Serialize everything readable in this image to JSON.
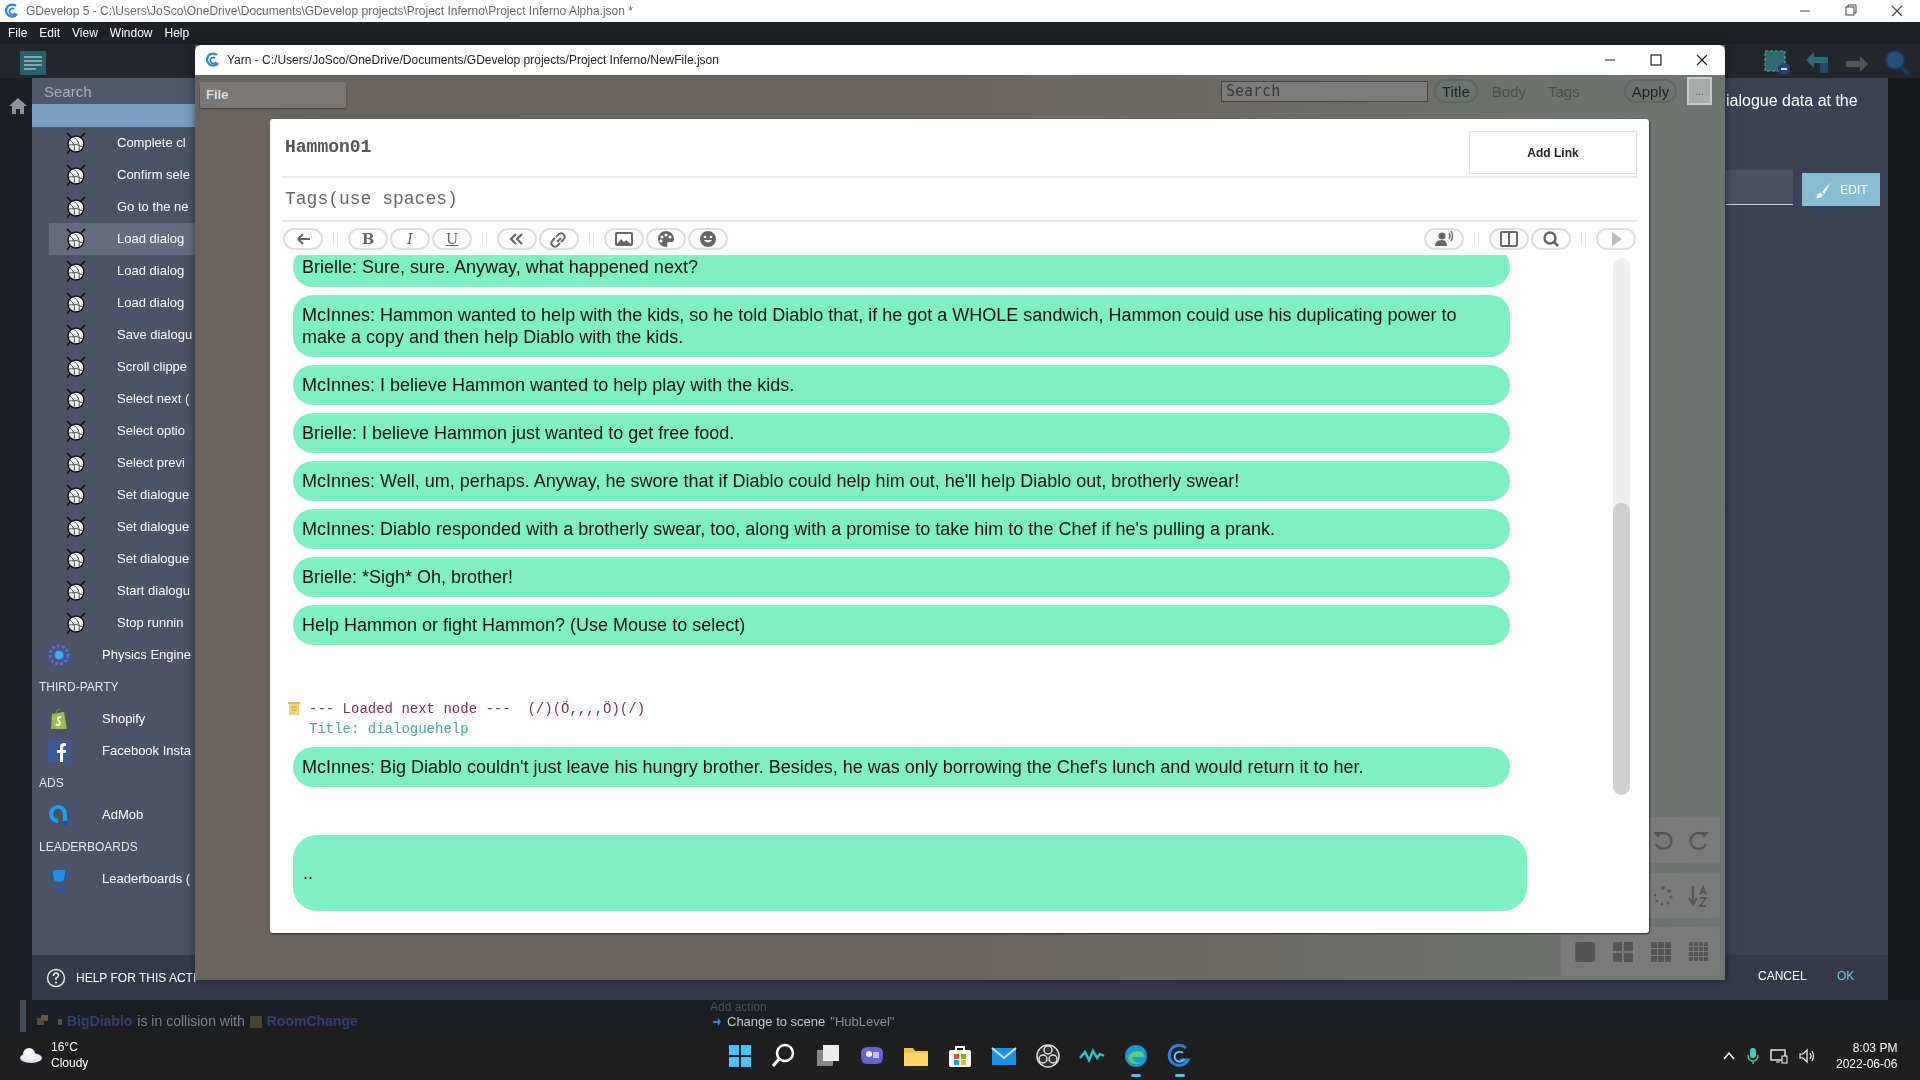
{
  "app": {
    "title": "GDevelop 5 - C:\\Users\\JoSco\\OneDrive\\Documents\\GDevelop projects\\Project Inferno\\Project Inferno Alpha.json *",
    "menu": [
      "File",
      "Edit",
      "View",
      "Window",
      "Help"
    ]
  },
  "action_dialog": {
    "search": {
      "placeholder": "Search"
    },
    "items": [
      {
        "kind": "yarn",
        "label": "Complete cl",
        "selected": false
      },
      {
        "kind": "yarn",
        "label": "Confirm sele",
        "selected": false
      },
      {
        "kind": "yarn",
        "label": "Go to the ne",
        "selected": false
      },
      {
        "kind": "yarn",
        "label": "Load dialog",
        "selected": true
      },
      {
        "kind": "yarn",
        "label": "Load dialog",
        "selected": false
      },
      {
        "kind": "yarn",
        "label": "Load dialog",
        "selected": false
      },
      {
        "kind": "yarn",
        "label": "Save dialogu",
        "selected": false
      },
      {
        "kind": "yarn",
        "label": "Scroll clippe",
        "selected": false
      },
      {
        "kind": "yarn",
        "label": "Select next (",
        "selected": false
      },
      {
        "kind": "yarn",
        "label": "Select optio",
        "selected": false
      },
      {
        "kind": "yarn",
        "label": "Select previ",
        "selected": false
      },
      {
        "kind": "yarn",
        "label": "Set dialogue",
        "selected": false
      },
      {
        "kind": "yarn",
        "label": "Set dialogue",
        "selected": false
      },
      {
        "kind": "yarn",
        "label": "Set dialogue",
        "selected": false
      },
      {
        "kind": "yarn",
        "label": "Start dialogu",
        "selected": false
      },
      {
        "kind": "yarn",
        "label": "Stop runnin",
        "selected": false
      },
      {
        "kind": "physics",
        "label": "Physics Engine",
        "selected": false
      },
      {
        "kind": "heading",
        "label": "THIRD-PARTY"
      },
      {
        "kind": "shopify",
        "label": "Shopify",
        "selected": false
      },
      {
        "kind": "facebook",
        "label": "Facebook Insta",
        "selected": false
      },
      {
        "kind": "heading",
        "label": "ADS"
      },
      {
        "kind": "admob",
        "label": "AdMob",
        "selected": false
      },
      {
        "kind": "heading",
        "label": "LEADERBOARDS"
      },
      {
        "kind": "trophy",
        "label": "Leaderboards (",
        "selected": false
      }
    ],
    "description": "ialogue data at the",
    "edit_button": "EDIT",
    "help": "HELP FOR THIS ACTI",
    "cancel": "CANCEL",
    "ok": "OK"
  },
  "yarn": {
    "title": "Yarn - C:/Users/JoSco/OneDrive/Documents/GDevelop projects/Project Inferno/NewFile.json",
    "file_menu": "File",
    "search": {
      "placeholder": "Search"
    },
    "filters": [
      {
        "label": "Title",
        "selected": true
      },
      {
        "label": "Body",
        "selected": false
      },
      {
        "label": "Tags",
        "selected": false
      }
    ],
    "apply": "Apply",
    "more": "...",
    "node": {
      "title": "Hammon01",
      "add_link": "Add Link",
      "tags": {
        "placeholder": "Tags(use spaces)"
      },
      "toolbar_groups": [
        [
          {
            "kind": "back"
          }
        ],
        [
          {
            "kind": "bold",
            "label": "B"
          },
          {
            "kind": "italic",
            "label": "I"
          },
          {
            "kind": "underline",
            "label": "U"
          }
        ],
        [
          {
            "kind": "quote"
          },
          {
            "kind": "link"
          }
        ],
        [
          {
            "kind": "image"
          },
          {
            "kind": "palette"
          },
          {
            "kind": "emoji"
          }
        ]
      ],
      "toolbar_right_groups": [
        [
          {
            "kind": "voice"
          }
        ],
        [
          {
            "kind": "split"
          },
          {
            "kind": "search"
          }
        ],
        [
          {
            "kind": "play"
          }
        ]
      ],
      "lines": [
        {
          "kind": "bubble",
          "text": "Brielle: Sure, sure. Anyway, what happened next?"
        },
        {
          "kind": "bubble",
          "text": "McInnes: Hammon wanted to help with the kids, so he told Diablo that, if he got a WHOLE sandwich, Hammon could use his duplicating power to make a copy and then help Diablo with the kids."
        },
        {
          "kind": "bubble",
          "text": "McInnes: I believe Hammon wanted to help play with the kids."
        },
        {
          "kind": "bubble",
          "text": "Brielle: I believe Hammon just wanted to get free food."
        },
        {
          "kind": "bubble",
          "text": "McInnes: Well, um, perhaps. Anyway, he swore that if Diablo could help him out, he'll help Diablo out, brotherly swear!"
        },
        {
          "kind": "bubble",
          "text": "McInnes: Diablo responded with a brotherly swear, too, along with a promise to take him to the Chef if he's pulling a prank."
        },
        {
          "kind": "bubble",
          "text": "Brielle: *Sigh* Oh, brother!"
        },
        {
          "kind": "bubble",
          "text": "Help Hammon or fight Hammon? (Use Mouse to select)"
        },
        {
          "kind": "node_marker",
          "text": "--- Loaded next node ---  (/)(Ö,,,,Ö)(/)",
          "title": "Title: dialoguehelp"
        },
        {
          "kind": "bubble",
          "text": "McInnes: Big Diablo couldn't just leave his hungry brother. Besides, he was only borrowing the Chef's lunch and would return it to her."
        }
      ],
      "input": {
        "value": ".."
      }
    }
  },
  "events": {
    "add_action": "Add action",
    "condition": {
      "object": "BigDiablo",
      "text": "is in collision with",
      "target": "RoomChange"
    },
    "action": {
      "text": "Change to scene",
      "value": "\"HubLevel\""
    }
  },
  "taskbar": {
    "temperature": "16°C",
    "weather": "Cloudy",
    "time": "8:03 PM",
    "date": "2022-06-06",
    "apps": [
      {
        "kind": "start",
        "running": false
      },
      {
        "kind": "search",
        "running": false
      },
      {
        "kind": "taskview",
        "running": false
      },
      {
        "kind": "chat",
        "running": false
      },
      {
        "kind": "explorer",
        "running": false
      },
      {
        "kind": "store",
        "running": false
      },
      {
        "kind": "mail",
        "running": false
      },
      {
        "kind": "obs",
        "running": false
      },
      {
        "kind": "wave",
        "running": false
      },
      {
        "kind": "edge",
        "running": true
      },
      {
        "kind": "gdevelop",
        "running": true
      }
    ]
  }
}
